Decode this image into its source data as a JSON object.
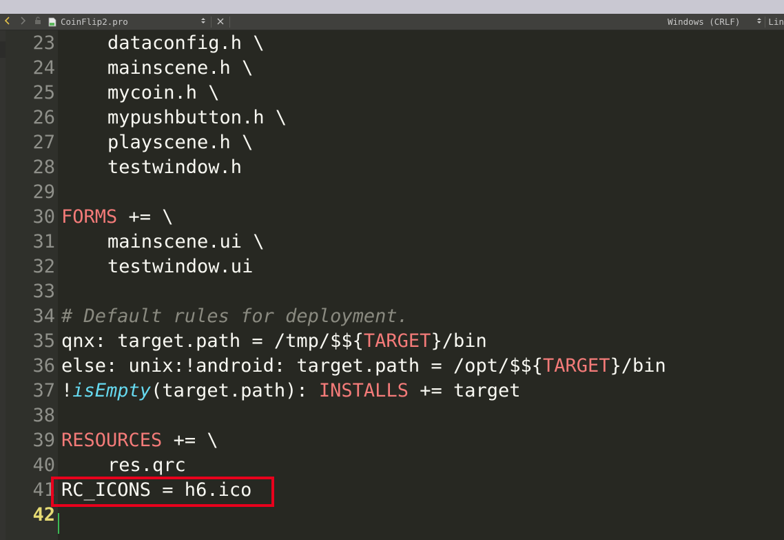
{
  "toolbar": {
    "back_icon": "chevron-left-icon",
    "forward_icon": "chevron-right-icon",
    "lock_icon": "lock-icon",
    "file_icon": "qt-project-file-icon",
    "file_name": "CoinFlip2.pro",
    "line_ending": "Windows (CRLF)",
    "right_combo_label": "Lin",
    "colors": {
      "back_arrow": "#e6c34a",
      "file_icon": "#5cb85c"
    }
  },
  "editor": {
    "current_line": "42",
    "lines": [
      {
        "num": "23",
        "indent": true,
        "segments": [
          {
            "t": "dataconfig.h \\",
            "c": ""
          }
        ]
      },
      {
        "num": "24",
        "indent": true,
        "segments": [
          {
            "t": "mainscene.h \\",
            "c": ""
          }
        ]
      },
      {
        "num": "25",
        "indent": true,
        "segments": [
          {
            "t": "mycoin.h \\",
            "c": ""
          }
        ]
      },
      {
        "num": "26",
        "indent": true,
        "segments": [
          {
            "t": "mypushbutton.h \\",
            "c": ""
          }
        ]
      },
      {
        "num": "27",
        "indent": true,
        "segments": [
          {
            "t": "playscene.h \\",
            "c": ""
          }
        ]
      },
      {
        "num": "28",
        "indent": true,
        "segments": [
          {
            "t": "testwindow.h",
            "c": ""
          }
        ]
      },
      {
        "num": "29",
        "indent": false,
        "segments": []
      },
      {
        "num": "30",
        "indent": false,
        "segments": [
          {
            "t": "FORMS",
            "c": "kw"
          },
          {
            "t": " += \\",
            "c": ""
          }
        ]
      },
      {
        "num": "31",
        "indent": true,
        "segments": [
          {
            "t": "mainscene.ui \\",
            "c": ""
          }
        ]
      },
      {
        "num": "32",
        "indent": true,
        "segments": [
          {
            "t": "testwindow.ui",
            "c": ""
          }
        ]
      },
      {
        "num": "33",
        "indent": false,
        "segments": []
      },
      {
        "num": "34",
        "indent": false,
        "segments": [
          {
            "t": "# Default rules for deployment.",
            "c": "cm"
          }
        ]
      },
      {
        "num": "35",
        "indent": false,
        "segments": [
          {
            "t": "qnx: target.path = /tmp/$${",
            "c": ""
          },
          {
            "t": "TARGET",
            "c": "kw"
          },
          {
            "t": "}/bin",
            "c": ""
          }
        ]
      },
      {
        "num": "36",
        "indent": false,
        "segments": [
          {
            "t": "else: unix:!android: target.path = /opt/$${",
            "c": ""
          },
          {
            "t": "TARGET",
            "c": "kw"
          },
          {
            "t": "}/bin",
            "c": ""
          }
        ]
      },
      {
        "num": "37",
        "indent": false,
        "segments": [
          {
            "t": "!",
            "c": ""
          },
          {
            "t": "isEmpty",
            "c": "fn"
          },
          {
            "t": "(target.path): ",
            "c": ""
          },
          {
            "t": "INSTALLS",
            "c": "kw"
          },
          {
            "t": " += target",
            "c": ""
          }
        ]
      },
      {
        "num": "38",
        "indent": false,
        "segments": []
      },
      {
        "num": "39",
        "indent": false,
        "segments": [
          {
            "t": "RESOURCES",
            "c": "kw"
          },
          {
            "t": " += \\",
            "c": ""
          }
        ]
      },
      {
        "num": "40",
        "indent": true,
        "segments": [
          {
            "t": "res.qrc",
            "c": ""
          }
        ]
      },
      {
        "num": "41",
        "indent": false,
        "segments": [
          {
            "t": "RC_ICONS = h6.ico",
            "c": ""
          }
        ]
      },
      {
        "num": "42",
        "indent": false,
        "segments": []
      }
    ],
    "colors": {
      "background": "#272822",
      "text": "#f8f8f2",
      "keyword": "#f47b79",
      "comment": "#8a8a80",
      "function": "#66d9ef",
      "highlight_box": "#e8001c",
      "cursor": "#3cba54"
    }
  }
}
